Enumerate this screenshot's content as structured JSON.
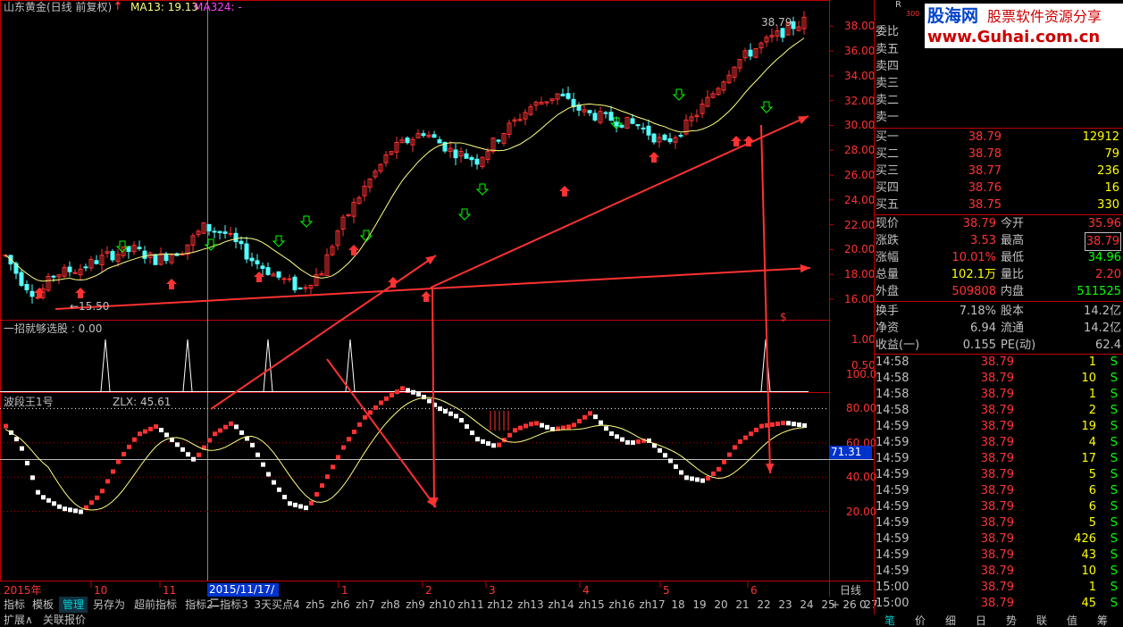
{
  "header": {
    "stock_title": "山东黄金(日线 前复权)",
    "ma13_label": "MA13: 19.13",
    "ma324_label": "MA324: -",
    "price_max_label": "38.79",
    "price_min_label": "←15.50"
  },
  "price_axis": [
    "38.00",
    "36.00",
    "34.00",
    "32.00",
    "30.00",
    "28.00",
    "26.00",
    "24.00",
    "22.00",
    "20.00",
    "18.00",
    "16.00"
  ],
  "indicator1": {
    "title": "一招就够选股 : 0.00",
    "axis": [
      "1.00",
      "0.50"
    ],
    "signal_marker": "$"
  },
  "indicator2": {
    "title": "波段王1号",
    "zlx_label": "ZLX: 45.61",
    "axis": [
      "100.0",
      "80.00",
      "60.00",
      "40.00",
      "20.00"
    ],
    "current_value": "71.31"
  },
  "time_axis": {
    "year_label": "2015年",
    "labels": [
      "10",
      "11",
      "1",
      "2",
      "3",
      "4",
      "5",
      "6"
    ],
    "cursor_date": "2015/11/17/二",
    "period_label": "日线"
  },
  "tabs": [
    "指标",
    "模板",
    "管理",
    "另存为",
    "超前指标",
    "指标2",
    "指标3",
    "3天买点4",
    "zh5",
    "zh6",
    "zh7",
    "zh8",
    "zh9",
    "zh10",
    "zh11",
    "zh12",
    "zh13",
    "zh14",
    "zh15",
    "zh16",
    "zh17",
    "18",
    "19",
    "20",
    "21",
    "22",
    "23",
    "24",
    "25",
    "26",
    "27"
  ],
  "nav_buttons": [
    "+",
    "-",
    "0"
  ],
  "bottom_bar": {
    "expand": "扩展∧",
    "related": "关联报价"
  },
  "watermark": {
    "logo": "股海网",
    "slogan": "股票软件资源分享",
    "url": "www.Guhai.com.cn",
    "r_label": "R",
    "r_sub": "300"
  },
  "order_book": {
    "ratio_label": "委比",
    "sells": [
      {
        "label": "卖五",
        "price": "",
        "vol": ""
      },
      {
        "label": "卖四",
        "price": "",
        "vol": ""
      },
      {
        "label": "卖三",
        "price": "",
        "vol": ""
      },
      {
        "label": "卖二",
        "price": "",
        "vol": ""
      },
      {
        "label": "卖一",
        "price": "",
        "vol": ""
      }
    ],
    "buys": [
      {
        "label": "买一",
        "price": "38.79",
        "vol": "12912"
      },
      {
        "label": "买二",
        "price": "38.78",
        "vol": "79"
      },
      {
        "label": "买三",
        "price": "38.77",
        "vol": "236"
      },
      {
        "label": "买四",
        "price": "38.76",
        "vol": "16"
      },
      {
        "label": "买五",
        "price": "38.75",
        "vol": "330"
      }
    ]
  },
  "quote": [
    {
      "l1": "现价",
      "v1": "38.79",
      "l2": "今开",
      "v2": "35.96"
    },
    {
      "l1": "涨跌",
      "v1": "3.53",
      "l2": "最高",
      "v2": "38.79"
    },
    {
      "l1": "涨幅",
      "v1": "10.01%",
      "l2": "最低",
      "v2": "34.96"
    },
    {
      "l1": "总量",
      "v1": "102.1万",
      "l2": "量比",
      "v2": "2.20"
    },
    {
      "l1": "外盘",
      "v1": "509808",
      "l2": "内盘",
      "v2": "511525"
    },
    {
      "l1": "换手",
      "v1": "7.18%",
      "l2": "股本",
      "v2": "14.2亿"
    },
    {
      "l1": "净资",
      "v1": "6.94",
      "l2": "流通",
      "v2": "14.2亿"
    },
    {
      "l1": "收益(一)",
      "v1": "0.155",
      "l2": "PE(动)",
      "v2": "62.4"
    }
  ],
  "trades": [
    {
      "t": "14:58",
      "p": "38.79",
      "v": "1",
      "s": "S"
    },
    {
      "t": "14:58",
      "p": "38.79",
      "v": "10",
      "s": "S"
    },
    {
      "t": "14:58",
      "p": "38.79",
      "v": "1",
      "s": "S"
    },
    {
      "t": "14:58",
      "p": "38.79",
      "v": "2",
      "s": "S"
    },
    {
      "t": "14:59",
      "p": "38.79",
      "v": "19",
      "s": "S"
    },
    {
      "t": "14:59",
      "p": "38.79",
      "v": "4",
      "s": "S"
    },
    {
      "t": "14:59",
      "p": "38.79",
      "v": "17",
      "s": "S"
    },
    {
      "t": "14:59",
      "p": "38.79",
      "v": "5",
      "s": "S"
    },
    {
      "t": "14:59",
      "p": "38.79",
      "v": "6",
      "s": "S"
    },
    {
      "t": "14:59",
      "p": "38.79",
      "v": "6",
      "s": "S"
    },
    {
      "t": "14:59",
      "p": "38.79",
      "v": "5",
      "s": "S"
    },
    {
      "t": "14:59",
      "p": "38.79",
      "v": "426",
      "s": "S"
    },
    {
      "t": "14:59",
      "p": "38.79",
      "v": "43",
      "s": "S"
    },
    {
      "t": "14:59",
      "p": "38.79",
      "v": "10",
      "s": "S"
    },
    {
      "t": "15:00",
      "p": "38.79",
      "v": "1",
      "s": "S"
    },
    {
      "t": "15:00",
      "p": "38.79",
      "v": "45",
      "s": "S"
    }
  ],
  "right_tabs": [
    "笔",
    "价",
    "细",
    "日",
    "势",
    "联",
    "值",
    "筹"
  ],
  "colors": {
    "up": "#ff3232",
    "down": "#54ffff",
    "ma": "#ffff80",
    "grid": "#8b0000",
    "frame": "#c00000",
    "text": "#c0c0c0",
    "yellow": "#ffff00",
    "green": "#00ff00",
    "blue": "#0033cc"
  }
}
